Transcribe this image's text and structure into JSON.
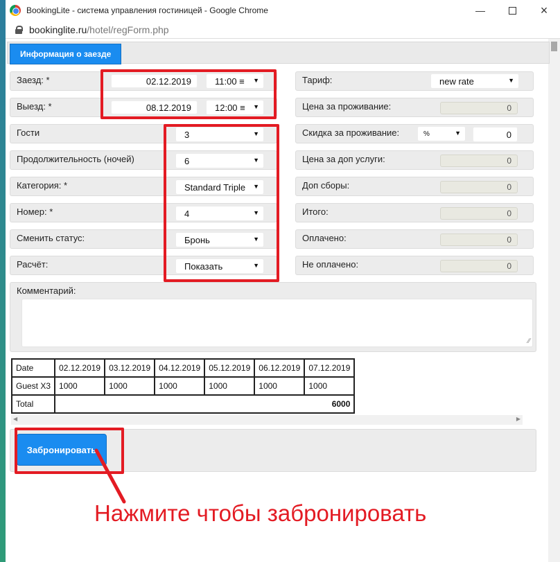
{
  "browser": {
    "title": "BookingLite - система управления гостиницей - Google Chrome",
    "url_host": "bookinglite.ru",
    "url_path": "/hotel/regForm.php",
    "controls": [
      "minimize",
      "maximize",
      "close"
    ]
  },
  "tab": {
    "label": "Информация о заезде"
  },
  "left": {
    "checkin": {
      "label": "Заезд: *",
      "date": "02.12.2019",
      "time": "11:00 ≡"
    },
    "checkout": {
      "label": "Выезд: *",
      "date": "08.12.2019",
      "time": "12:00 ≡"
    },
    "guests": {
      "label": "Гости",
      "value": "3"
    },
    "nights": {
      "label": "Продолжительность (ночей)",
      "value": "6"
    },
    "category": {
      "label": "Категория: *",
      "value": "Standard Triple"
    },
    "room": {
      "label": "Номер: *",
      "value": "4"
    },
    "status": {
      "label": "Сменить статус:",
      "value": "Бронь"
    },
    "calc": {
      "label": "Расчёт:",
      "value": "Показать"
    }
  },
  "right": {
    "tariff": {
      "label": "Тариф:",
      "value": "new rate"
    },
    "price": {
      "label": "Цена за проживание:",
      "value": "0"
    },
    "discount": {
      "label": "Скидка за проживание:",
      "unit": "%",
      "value": "0"
    },
    "extra_price": {
      "label": "Цена за доп услуги:",
      "value": "0"
    },
    "extra_fees": {
      "label": "Доп сборы:",
      "value": "0"
    },
    "total": {
      "label": "Итого:",
      "value": "0"
    },
    "paid": {
      "label": "Оплачено:",
      "value": "0"
    },
    "unpaid": {
      "label": "Не оплачено:",
      "value": "0"
    }
  },
  "comment": {
    "label": "Комментарий:",
    "value": ""
  },
  "table": {
    "header": [
      "Date",
      "02.12.2019",
      "03.12.2019",
      "04.12.2019",
      "05.12.2019",
      "06.12.2019",
      "07.12.2019"
    ],
    "row": [
      "Guest X3",
      "1000",
      "1000",
      "1000",
      "1000",
      "1000",
      "1000"
    ],
    "total_label": "Total",
    "total_value": "6000"
  },
  "book_button": "Забронировать",
  "hint": "Нажмите чтобы забронировать",
  "colors": {
    "accent": "#1a8cf0",
    "annotation": "#e31b23"
  },
  "arrow_glyph": "▼"
}
